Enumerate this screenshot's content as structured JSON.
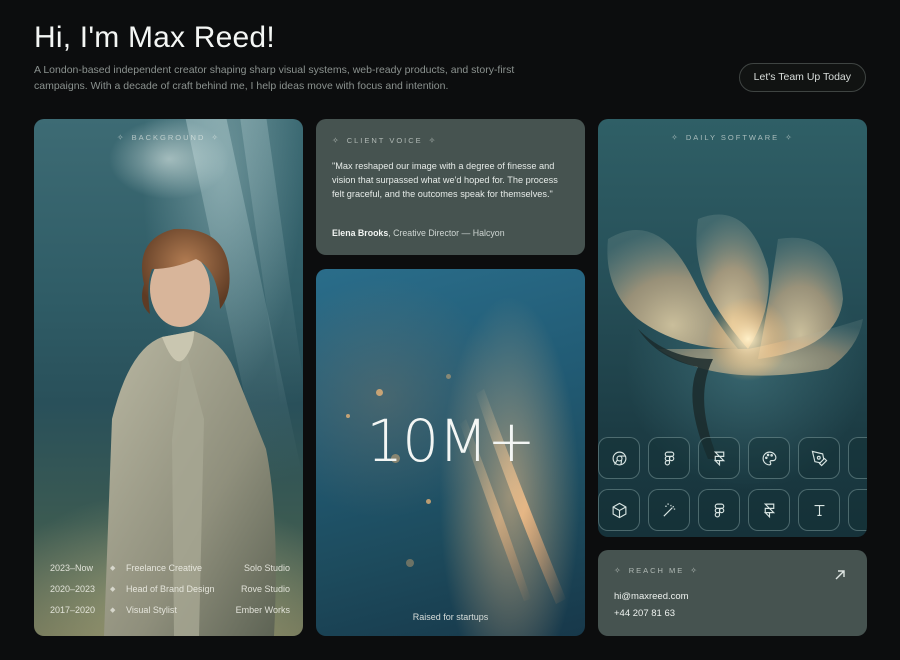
{
  "header": {
    "title": "Hi, I'm Max Reed!",
    "intro": "A London-based independent creator shaping sharp visual systems, web-ready products, and story-first campaigns. With a decade of craft behind me, I help ideas move with focus and intention.",
    "cta_label": "Let's Team Up Today"
  },
  "background_card": {
    "label": "BACKGROUND",
    "timeline": [
      {
        "years": "2023–Now",
        "role": "Freelance Creative",
        "place": "Solo Studio"
      },
      {
        "years": "2020–2023",
        "role": "Head of Brand Design",
        "place": "Rove Studio"
      },
      {
        "years": "2017–2020",
        "role": "Visual Stylist",
        "place": "Ember Works"
      }
    ]
  },
  "client_voice": {
    "label": "CLIENT VOICE",
    "quote": "\"Max reshaped our image with a degree of finesse and vision that surpassed what we'd hoped for. The process felt graceful, and the outcomes speak for themselves.\"",
    "author": "Elena Brooks",
    "author_role": ", Creative Director — Halcyon"
  },
  "stat_card": {
    "value": "10M+",
    "caption": "Raised for startups"
  },
  "software_card": {
    "label": "DAILY SOFTWARE",
    "apps_row1": [
      "chrome-icon",
      "figma-icon",
      "framer-icon",
      "palette-icon",
      "pen-tool-icon"
    ],
    "apps_row2": [
      "cube-icon",
      "magic-wand-icon",
      "figma-icon",
      "framer-icon",
      "type-icon"
    ]
  },
  "reach_card": {
    "label": "REACH ME",
    "email": "hi@maxreed.com",
    "phone": "+44 207 81 63"
  }
}
